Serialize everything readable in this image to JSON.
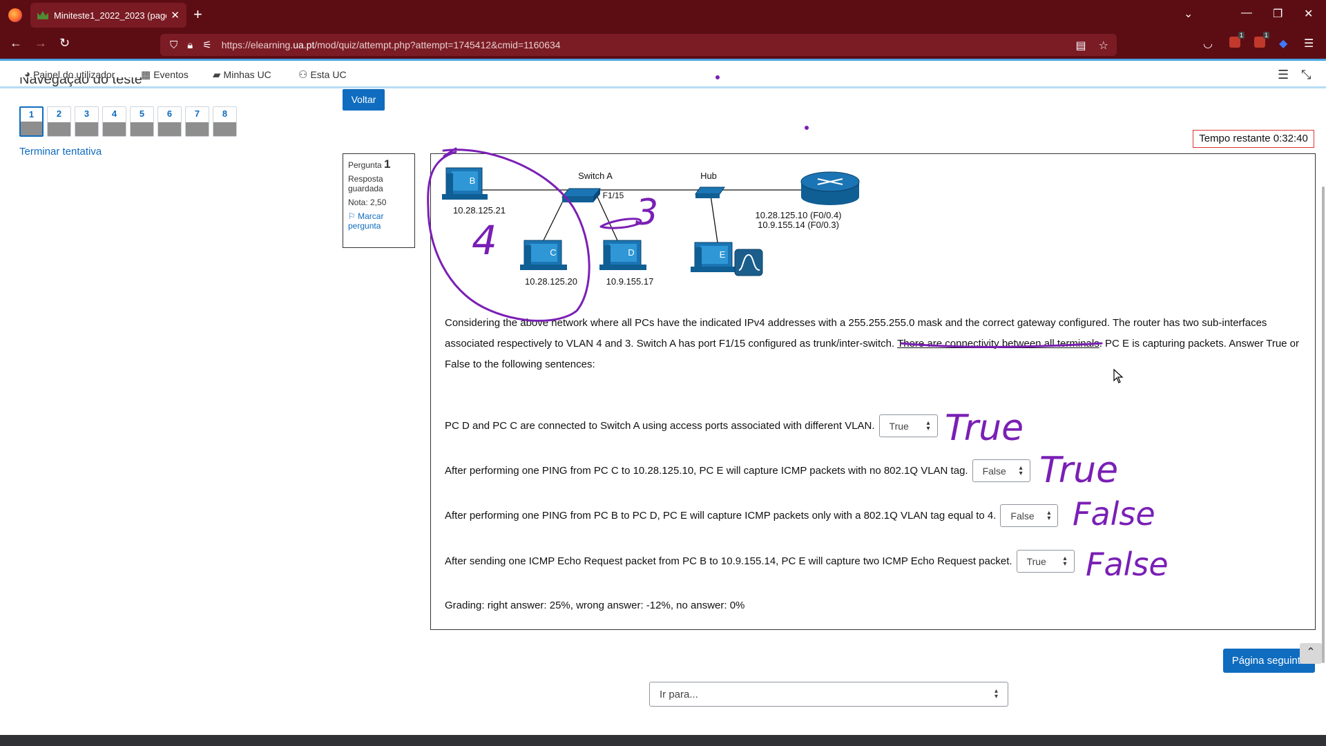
{
  "browser": {
    "tab_title": "Miniteste1_2022_2023 (page 1 o",
    "url_prefix": "https://elearning.",
    "url_domain": "ua.pt",
    "url_path": "/mod/quiz/attempt.php?attempt=1745412&cmid=1160634",
    "badges": [
      "1",
      "1"
    ]
  },
  "moodle_nav": {
    "items": [
      "Painel do utilizador",
      "Eventos",
      "Minhas UC",
      "Esta UC"
    ]
  },
  "quiz_nav": {
    "title": "Navegação do teste",
    "questions": [
      "1",
      "2",
      "3",
      "4",
      "5",
      "6",
      "7",
      "8"
    ],
    "current": 0,
    "finish_link": "Terminar tentativa"
  },
  "back_button": "Voltar",
  "timer": "Tempo restante 0:32:40",
  "question_info": {
    "label": "Pergunta",
    "number": "1",
    "state": "Resposta guardada",
    "mark": "Nota: 2,50",
    "flag": "Marcar pergunta"
  },
  "diagram": {
    "switch_label": "Switch A",
    "port_label": "F1/15",
    "hub_label": "Hub",
    "router_ip1": "10.28.125.10 (F0/0.4)",
    "router_ip2": "10.9.155.14 (F0/0.3)",
    "pc_b": "B",
    "pc_b_ip": "10.28.125.21",
    "pc_c": "C",
    "pc_c_ip": "10.28.125.20",
    "pc_d": "D",
    "pc_d_ip": "10.9.155.17",
    "pc_e": "E"
  },
  "question": {
    "text_part1": "Considering the above network where all PCs have the indicated IPv4 addresses with a 255.255.255.0 mask and the correct gateway configured. The router has two sub-interfaces associated respectively to VLAN 4 and 3. Switch A has port F1/15 configured as trunk/inter-switch. ",
    "text_underlined": "There are connectivity between all terminals",
    "text_part2": ". PC E is capturing packets. Answer True or False to the following sentences:",
    "sentences": [
      {
        "text": "PC D and PC C are connected to Switch A using access ports associated with different VLAN.",
        "answer": "True"
      },
      {
        "text": "After performing one PING from PC C to 10.28.125.10, PC E will capture ICMP packets with no 802.1Q VLAN tag.",
        "answer": "False"
      },
      {
        "text": "After performing one PING from PC B to PC D, PC E will capture ICMP packets only with a 802.1Q VLAN tag equal to 4.",
        "answer": "False"
      },
      {
        "text": "After sending one ICMP Echo Request packet from PC B to 10.9.155.14, PC E will capture two ICMP Echo Request packet.",
        "answer": "True"
      }
    ],
    "grading": "Grading: right answer: 25%, wrong answer: -12%, no answer: 0%"
  },
  "handwriting": {
    "vlan_left": "4",
    "vlan_right": "3",
    "notes": [
      "True",
      "True",
      "False",
      "False"
    ]
  },
  "next_button": "Página seguinte",
  "goto_select": "Ir para..."
}
